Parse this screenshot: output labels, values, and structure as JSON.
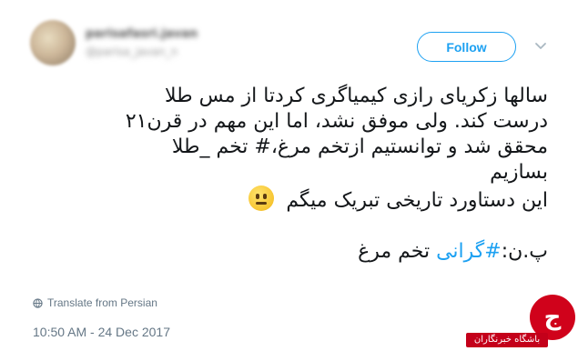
{
  "header": {
    "display_name": "parisafasri.javan",
    "handle": "@parisa_javan_n"
  },
  "follow_label": "Follow",
  "tweet": {
    "lines": [
      "سالها زکریای رازی کیمیاگری کردتا از مس طلا",
      "درست کند. ولی موفق نشد، اما این مهم در قرن۲۱",
      "محقق شد و توانستیم ازتخم مرغ،# تخم _طلا",
      "بسازیم",
      "این دستاورد تاریخی تبریک میگم"
    ],
    "last_prefix": "پ.ن:",
    "hashtag": "#گرانی",
    "last_suffix": " تخم مرغ"
  },
  "translate_label": "Translate from Persian",
  "timestamp": "10:50 AM - 24 Dec 2017",
  "watermark": "باشگاه خبرنگاران",
  "colors": {
    "accent": "#1da1f2",
    "badge": "#d0021b",
    "muted": "#657786"
  },
  "icons": [
    "chevron-down-icon",
    "globe-icon",
    "neutral-face-emoji"
  ]
}
